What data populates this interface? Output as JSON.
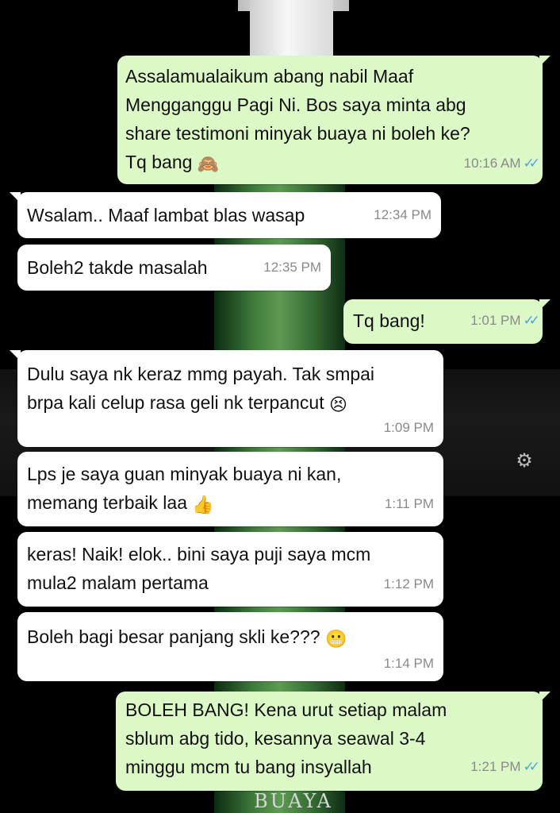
{
  "background": {
    "brand_text": "BUAYA"
  },
  "messages": [
    {
      "id": "m1",
      "dir": "out",
      "text": "Assalamualaikum abang nabil Maaf\nMengganggu Pagi Ni. Bos saya minta abg\nshare testimoni minyak buaya ni boleh ke?\nTq bang",
      "emoji": "🙈",
      "time": "10:16 AM",
      "read": "✓✓"
    },
    {
      "id": "m2",
      "dir": "in",
      "text": "Wsalam.. Maaf lambat blas wasap",
      "time": "12:34 PM"
    },
    {
      "id": "m3",
      "dir": "in",
      "text": "Boleh2 takde masalah",
      "time": "12:35 PM"
    },
    {
      "id": "m4",
      "dir": "out",
      "text": "Tq bang!",
      "time": "1:01 PM",
      "read": "✓✓"
    },
    {
      "id": "m5",
      "dir": "in",
      "text": "Dulu saya nk keraz mmg payah. Tak smpai\nbrpa kali celup rasa geli nk terpancut",
      "emoji": "😣",
      "time": "1:09 PM"
    },
    {
      "id": "m6",
      "dir": "in",
      "text": "Lps je saya guan minyak buaya ni kan,\nmemang terbaik laa",
      "emoji": "👍",
      "time": "1:11 PM"
    },
    {
      "id": "m7",
      "dir": "in",
      "text": "keras! Naik! elok.. bini saya puji saya mcm\nmula2 malam pertama",
      "time": "1:12 PM"
    },
    {
      "id": "m8",
      "dir": "in",
      "text": "Boleh bagi besar panjang skli ke???",
      "emoji": "😬",
      "time": "1:14 PM"
    },
    {
      "id": "m9",
      "dir": "out",
      "text": "BOLEH BANG! Kena urut setiap malam\nsblum abg tido, kesannya seawal 3-4\nminggu mcm tu bang insyallah",
      "time": "1:21 PM",
      "read": "✓✓"
    }
  ],
  "colors": {
    "outgoing_bubble": "#dcf8c6",
    "incoming_bubble": "#ffffff",
    "read_ticks": "#4fa3e0"
  }
}
